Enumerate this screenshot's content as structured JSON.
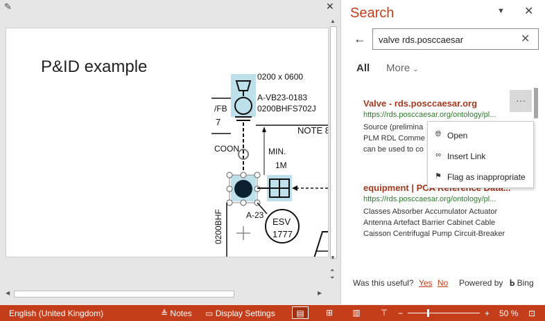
{
  "slide": {
    "title": "P&ID example",
    "diagram_labels": {
      "size": "0200 x 0600",
      "valve_tag": "A-VB23-0183",
      "line_tag": "0200BHFS702J",
      "left_fb": "/FB",
      "left_7": "7",
      "note": "NOTE 8,",
      "left_coon": "COON",
      "min": "MIN.",
      "min_val": "1M",
      "a23": "A-23",
      "esv": "ESV",
      "esv_num": "1777",
      "vertical_tag": "0200BHF"
    }
  },
  "search": {
    "title": "Search",
    "query": "valve rds.posccaesar",
    "tabs": {
      "all": "All",
      "more": "More"
    },
    "results": [
      {
        "title": "Valve - rds.posccaesar.org",
        "url": "https://rds.posccaesar.org/ontology/pl...",
        "desc_lines": [
          "Source (prelimina",
          "PLM RDL Comme",
          "can be used to co"
        ]
      },
      {
        "title": "equipment | PCA Reference Data...",
        "url": "https://rds.posccaesar.org/ontology/pl...",
        "desc_lines": [
          "Classes Absorber Accumulator Actuator",
          "Antenna Artefact Barrier Cabinet Cable",
          "Caisson Centrifugal Pump Circuit-Breaker"
        ]
      }
    ],
    "context_menu": {
      "open": "Open",
      "insert_link": "Insert Link",
      "flag": "Flag as inappropriate"
    },
    "footer": {
      "useful": "Was this useful?",
      "yes": "Yes",
      "no": "No",
      "powered_by": "Powered by",
      "bing": "Bing"
    }
  },
  "statusbar": {
    "language": "English (United Kingdom)",
    "notes": "Notes",
    "display_settings": "Display Settings",
    "zoom_minus": "−",
    "zoom_plus": "+",
    "zoom_level": "50 %",
    "zoom_fraction": 0.28
  },
  "colors": {
    "accent": "#c43e1c",
    "url_green": "#2c7a2c",
    "selection_blue": "#add8e6"
  }
}
